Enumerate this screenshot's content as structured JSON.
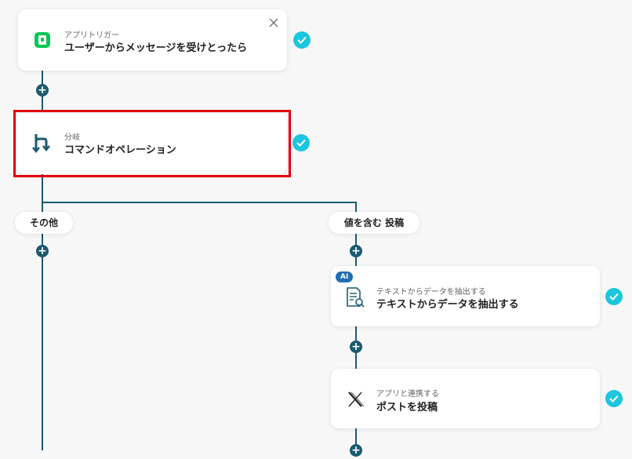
{
  "trigger": {
    "subtitle": "アプリトリガー",
    "title": "ユーザーからメッセージを受けとったら"
  },
  "branch": {
    "subtitle": "分岐",
    "title": "コマンドオペレーション"
  },
  "branches": {
    "left_label": "その他",
    "right_label": "値を含む 投稿"
  },
  "extract": {
    "badge": "AI",
    "subtitle": "テキストからデータを抽出する",
    "title": "テキストからデータを抽出する"
  },
  "post": {
    "subtitle": "アプリと連携する",
    "title": "ポストを投稿"
  },
  "icons": {
    "trigger": "line-app-icon",
    "branch": "branch-icon",
    "extract": "document-search-icon",
    "post": "x-logo-icon",
    "close": "close-icon",
    "check": "check-icon",
    "add": "plus-icon"
  },
  "plus_symbol": "+",
  "colors": {
    "connector": "#1a5a70",
    "check": "#1cc6dc",
    "highlight": "#e0000a",
    "line_green": "#06c755",
    "ai_badge": "#1f6fb3"
  }
}
